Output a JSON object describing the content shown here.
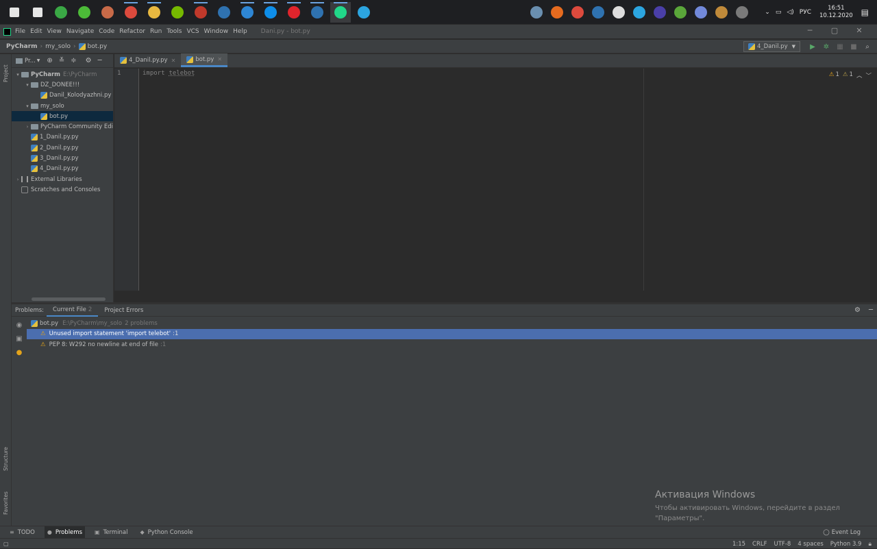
{
  "taskbar": {
    "apps": [
      {
        "name": "start-logo-icon",
        "color": "#e6e6e6"
      },
      {
        "name": "search-icon",
        "color": "#e6e6e6"
      },
      {
        "name": "app-green-icon",
        "color": "#3aa845"
      },
      {
        "name": "app-lime-icon",
        "color": "#4cba38"
      },
      {
        "name": "photo-app-icon",
        "color": "#c86a48"
      },
      {
        "name": "chrome-icon",
        "color": "#dc4a3d"
      },
      {
        "name": "file-explorer-icon",
        "color": "#e8b840"
      },
      {
        "name": "nvidia-icon",
        "color": "#76b900"
      },
      {
        "name": "app-shield-icon",
        "color": "#c0392b"
      },
      {
        "name": "steam-icon",
        "color": "#2f72b0"
      },
      {
        "name": "app-blue-icon",
        "color": "#2e86d4"
      },
      {
        "name": "teamviewer-icon",
        "color": "#0e8ee9"
      },
      {
        "name": "opera-icon",
        "color": "#e0242c"
      },
      {
        "name": "steam-icon-2",
        "color": "#2f72b0"
      },
      {
        "name": "pycharm-icon",
        "color": "#21d789"
      },
      {
        "name": "telegram-icon",
        "color": "#2ca5e0"
      }
    ],
    "tray_icons": [
      {
        "name": "tray-app-icon",
        "color": "#6a8fb0"
      },
      {
        "name": "firefox-icon",
        "color": "#e66b1f"
      },
      {
        "name": "chrome-tray-icon",
        "color": "#dc4a3d"
      },
      {
        "name": "steam-tray-icon",
        "color": "#2f72b0"
      },
      {
        "name": "tray-tool-icon",
        "color": "#dddddd"
      },
      {
        "name": "telegram-tray-icon",
        "color": "#2ca5e0"
      },
      {
        "name": "nfs-icon",
        "color": "#4a3fa8"
      },
      {
        "name": "xbox-icon",
        "color": "#5aa63a"
      },
      {
        "name": "discord-icon",
        "color": "#7289da"
      },
      {
        "name": "game-icon",
        "color": "#c08a3a"
      },
      {
        "name": "gta-icon",
        "color": "#7a7a7a"
      }
    ],
    "lang": "РУС",
    "time": "16:51",
    "date": "10.12.2020"
  },
  "menubar": {
    "items": [
      "File",
      "Edit",
      "View",
      "Navigate",
      "Code",
      "Refactor",
      "Run",
      "Tools",
      "VCS",
      "Window",
      "Help"
    ],
    "title": "Dani.py - bot.py"
  },
  "navbar": {
    "breadcrumbs": [
      "PyCharm",
      "my_solo",
      "bot.py"
    ],
    "run_config": "4_Danil.py"
  },
  "project": {
    "header": "Pr...",
    "tree": [
      {
        "label": "PyCharm",
        "extra": "E:\\PyCharm",
        "type": "folder",
        "indent": 0,
        "expanded": true
      },
      {
        "label": "DZ_DONEE!!!",
        "type": "folder",
        "indent": 1,
        "expanded": true
      },
      {
        "label": "Danil_Kolodyazhni.py",
        "type": "py",
        "indent": 2
      },
      {
        "label": "my_solo",
        "type": "folder",
        "indent": 1,
        "expanded": true
      },
      {
        "label": "bot.py",
        "type": "py",
        "indent": 2,
        "selected": true
      },
      {
        "label": "PyCharm Community Edi",
        "type": "folder",
        "indent": 1,
        "expanded": false
      },
      {
        "label": "1_Danil.py.py",
        "type": "py",
        "indent": 1
      },
      {
        "label": "2_Danil.py.py",
        "type": "py",
        "indent": 1
      },
      {
        "label": "3_Danil.py.py",
        "type": "py",
        "indent": 1
      },
      {
        "label": "4_Danil.py.py",
        "type": "py",
        "indent": 1
      },
      {
        "label": "External Libraries",
        "type": "lib",
        "indent": 0,
        "expanded": false
      },
      {
        "label": "Scratches and Consoles",
        "type": "scratch",
        "indent": 0
      }
    ]
  },
  "editor": {
    "tabs": [
      {
        "label": "4_Danil.py.py",
        "active": false
      },
      {
        "label": "bot.py",
        "active": true
      }
    ],
    "line_number": "1",
    "code_keyword": "import",
    "code_module": "telebot",
    "warnings_count": "1",
    "weak_warnings_count": "1"
  },
  "problems": {
    "title": "Problems:",
    "tabs": [
      {
        "label": "Current File",
        "count": "2",
        "active": true
      },
      {
        "label": "Project Errors",
        "count": "",
        "active": false
      }
    ],
    "file": {
      "name": "bot.py",
      "path": "E:\\PyCharm\\my_solo",
      "summary": "2 problems"
    },
    "items": [
      {
        "text": "Unused import statement 'import telebot'",
        "loc": ":1",
        "selected": true
      },
      {
        "text": "PEP 8: W292 no newline at end of file",
        "loc": ":1",
        "selected": false
      }
    ]
  },
  "watermark": {
    "title": "Активация Windows",
    "line1": "Чтобы активировать Windows, перейдите в раздел",
    "line2": "\"Параметры\"."
  },
  "left_strip": {
    "project": "Project",
    "structure": "Structure",
    "favorites": "Favorites"
  },
  "bottombar": {
    "tabs": [
      {
        "label": "TODO",
        "icon": "≡",
        "active": false
      },
      {
        "label": "Problems",
        "icon": "●",
        "active": true
      },
      {
        "label": "Terminal",
        "icon": "▣",
        "active": false
      },
      {
        "label": "Python Console",
        "icon": "◆",
        "active": false
      }
    ],
    "event_log": "Event Log"
  },
  "statusbar": {
    "position": "1:15",
    "line_sep": "CRLF",
    "encoding": "UTF-8",
    "indent": "4 spaces",
    "interpreter": "Python 3.9"
  }
}
